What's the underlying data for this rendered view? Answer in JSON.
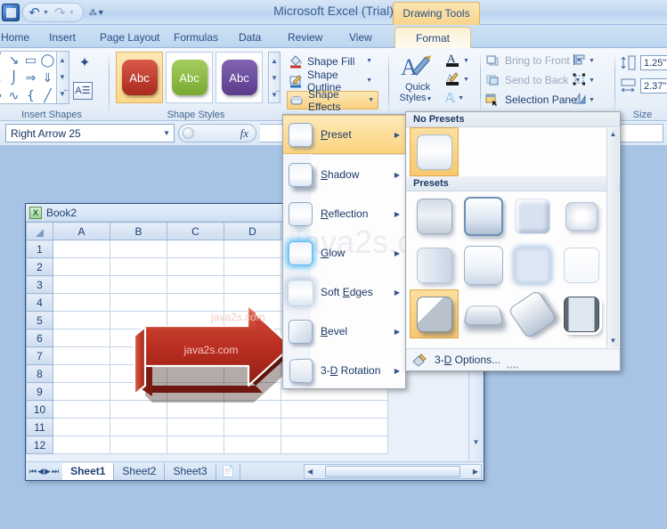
{
  "titlebar": {
    "app_title": "Microsoft Excel (Trial)",
    "contextual_tab_group": "Drawing Tools",
    "qat": {
      "office_button": "office-button",
      "undo": "Undo",
      "redo": "Redo",
      "customize": "Customize Quick Access Toolbar"
    }
  },
  "tabs": [
    {
      "label": "Home",
      "active": false
    },
    {
      "label": "Insert",
      "active": false
    },
    {
      "label": "Page Layout",
      "active": false
    },
    {
      "label": "Formulas",
      "active": false
    },
    {
      "label": "Data",
      "active": false
    },
    {
      "label": "Review",
      "active": false
    },
    {
      "label": "View",
      "active": false
    },
    {
      "label": "Format",
      "active": true
    }
  ],
  "ribbon": {
    "groups": [
      {
        "name": "Insert Shapes",
        "label": "Insert Shapes"
      },
      {
        "name": "Shape Styles",
        "label": "Shape Styles"
      },
      {
        "name": "WordArt Styles",
        "label": ""
      },
      {
        "name": "Arrange",
        "label": ""
      },
      {
        "name": "Size",
        "label": "Size"
      }
    ],
    "shape_fill": "Shape Fill",
    "shape_outline": "Shape Outline",
    "shape_effects": "Shape Effects",
    "quick_styles_line1": "Quick",
    "quick_styles_line2": "Styles",
    "bring_to_front": "Bring to Front",
    "send_to_back": "Send to Back",
    "selection_pane": "Selection Pane",
    "size_height": "1.25\"",
    "size_width": "2.37\"",
    "shape_styles": [
      {
        "label": "Abc",
        "color": "#c0392b",
        "selected": true
      },
      {
        "label": "Abc",
        "color": "#8cbd45",
        "selected": false
      },
      {
        "label": "Abc",
        "color": "#6c4a9e",
        "selected": false
      }
    ]
  },
  "formulabar": {
    "name_box_value": "Right Arrow 25",
    "fx_label": "fx",
    "formula_value": ""
  },
  "workbook": {
    "title": "Book2",
    "columns": [
      "A",
      "B",
      "C",
      "D"
    ],
    "rows": [
      "1",
      "2",
      "3",
      "4",
      "5",
      "6",
      "7",
      "8",
      "9",
      "10",
      "11",
      "12"
    ],
    "shape_text": "java2s.com",
    "sheet_tabs": [
      {
        "label": "Sheet1",
        "active": true
      },
      {
        "label": "Sheet2",
        "active": false
      },
      {
        "label": "Sheet3",
        "active": false
      }
    ],
    "insert_sheet": "insert-worksheet-icon"
  },
  "shape_effects_menu": {
    "items": [
      {
        "label": "Preset",
        "accel": "P",
        "selected": true,
        "submenu": true
      },
      {
        "label": "Shadow",
        "accel": "S",
        "selected": false,
        "submenu": true
      },
      {
        "label": "Reflection",
        "accel": "R",
        "selected": false,
        "submenu": true
      },
      {
        "label": "Glow",
        "accel": "G",
        "selected": false,
        "submenu": true
      },
      {
        "label": "Soft Edges",
        "accel": "E",
        "selected": false,
        "submenu": true
      },
      {
        "label": "Bevel",
        "accel": "B",
        "selected": false,
        "submenu": true
      },
      {
        "label": "3-D Rotation",
        "accel": "D",
        "selected": false,
        "submenu": true
      }
    ],
    "watermark": "java2s.com"
  },
  "preset_gallery": {
    "no_presets_header": "No Presets",
    "presets_header": "Presets",
    "no_presets_items": [
      {
        "name": "preset-none",
        "selected": true
      }
    ],
    "presets": [
      {
        "name": "preset-1",
        "selected": false
      },
      {
        "name": "preset-2",
        "selected": false
      },
      {
        "name": "preset-3",
        "selected": false
      },
      {
        "name": "preset-4",
        "selected": false
      },
      {
        "name": "preset-5",
        "selected": false
      },
      {
        "name": "preset-6",
        "selected": false
      },
      {
        "name": "preset-7",
        "selected": false
      },
      {
        "name": "preset-8",
        "selected": false
      },
      {
        "name": "preset-9",
        "selected": true
      },
      {
        "name": "preset-10",
        "selected": false
      },
      {
        "name": "preset-11",
        "selected": false
      },
      {
        "name": "preset-12",
        "selected": false
      }
    ],
    "options_label": "3-D Options..."
  },
  "colors": {
    "desktop": "#a7c4e6",
    "accent_orange": "#f8c86e",
    "tab_text": "#2a4d86",
    "shape_red": "#c0392b"
  }
}
